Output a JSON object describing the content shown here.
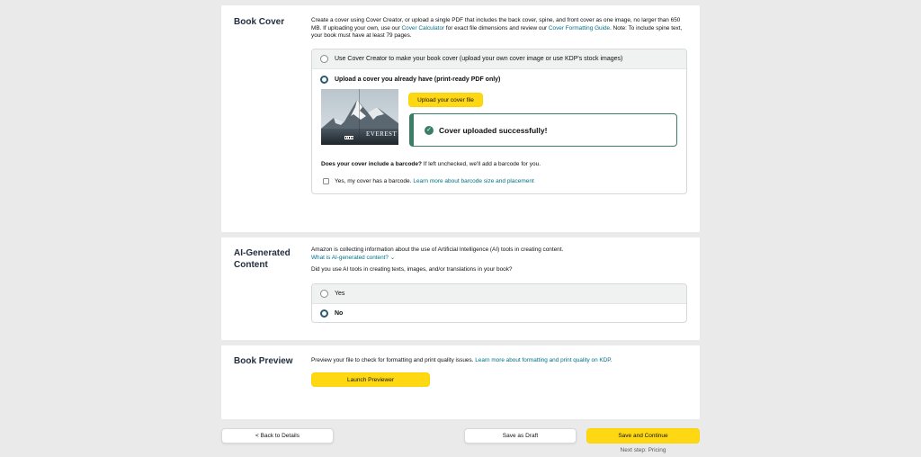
{
  "book_cover": {
    "title": "Book Cover",
    "desc_1": "Create a cover using Cover Creator, or upload a single PDF that includes the back cover, spine, and front cover as one image, no larger than 650 MB. If uploading your own, use our ",
    "link_calculator": "Cover Calculator",
    "desc_2": " for exact file dimensions and review our ",
    "link_guide": "Cover Formatting Guide",
    "desc_3": ". Note: To include spine text, your book must have at least 79 pages.",
    "option_creator": "Use Cover Creator to make your book cover (upload your own cover image or use KDP's stock images)",
    "option_upload": "Upload a cover you already have (print-ready PDF only)",
    "upload_button": "Upload your cover file",
    "success_message": "Cover uploaded successfully!",
    "cover_title_text": "EVEREST",
    "barcode_question": "Does your cover include a barcode?",
    "barcode_note": " If left unchecked, we'll add a barcode for you.",
    "barcode_checkbox_label": "Yes, my cover has a barcode. ",
    "barcode_link": "Learn more about barcode size and placement"
  },
  "ai_content": {
    "title_line1": "AI-Generated",
    "title_line2": "Content",
    "desc": "Amazon is collecting information about the use of Artificial Intelligence (AI) tools in creating content.",
    "link": "What is AI-generated content?",
    "link_chevron": "⌄",
    "question": "Did you use AI tools in creating texts, images, and/or translations in your book?",
    "option_yes": "Yes",
    "option_no": "No"
  },
  "book_preview": {
    "title": "Book Preview",
    "desc": "Preview your file to check for formatting and print quality issues. ",
    "link": "Learn more about formatting and print quality on KDP.",
    "launch_button": "Launch Previewer"
  },
  "footer": {
    "back_button": "< Back to Details",
    "draft_button": "Save as Draft",
    "continue_button": "Save and Continue",
    "next_step": "Next step: Pricing"
  },
  "colors": {
    "accent_yellow": "#ffd814",
    "success_green": "#3b7d66",
    "link_teal": "#007185",
    "radio_selected": "#2b5a6e"
  }
}
